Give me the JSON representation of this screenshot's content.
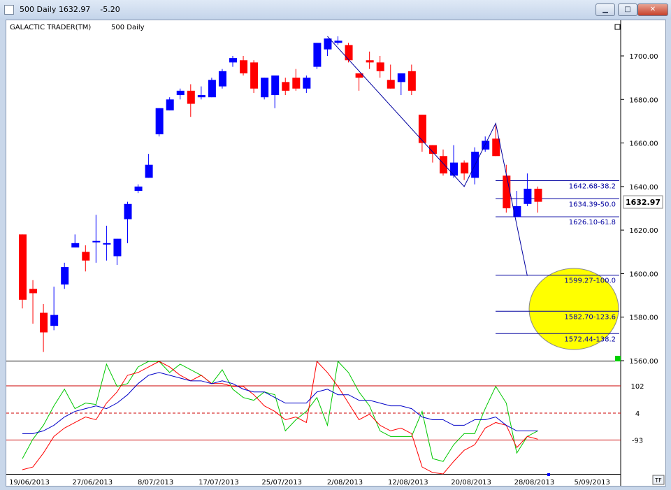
{
  "window": {
    "title": "500 Daily 1632.97    -5.20",
    "minimize_glyph": "▁",
    "maximize_glyph": "□",
    "close_glyph": "✕"
  },
  "chart_header": {
    "name": "GALACTIC TRADER(TM)",
    "instrument": "500 Daily"
  },
  "last_price_label": "1632.97",
  "tf_button": "TF",
  "colors": {
    "up": "#0000ff",
    "down": "#ff0000",
    "highlight": "#ffff00"
  },
  "chart_data": [
    {
      "type": "candlestick",
      "price_ylim": [
        1560,
        1710
      ],
      "y_ticks": [
        "1700.00",
        "1680.00",
        "1660.00",
        "1640.00",
        "1620.00",
        "1600.00",
        "1580.00",
        "1560.00"
      ],
      "x_ticks": [
        "19/06/2013",
        "27/06/2013",
        "8/07/2013",
        "17/07/2013",
        "25/07/2013",
        "2/08/2013",
        "12/08/2013",
        "20/08/2013",
        "28/08/2013",
        "5/09/2013"
      ],
      "candles": [
        [
          1618,
          1618,
          1584,
          1588
        ],
        [
          1593,
          1597,
          1577,
          1591
        ],
        [
          1582,
          1586,
          1564,
          1573
        ],
        [
          1576,
          1594,
          1574,
          1581
        ],
        [
          1595,
          1605,
          1593,
          1603
        ],
        [
          1612,
          1618,
          1612,
          1614
        ],
        [
          1610,
          1613,
          1601,
          1606
        ],
        [
          1615,
          1627,
          1605,
          1615
        ],
        [
          1614,
          1622,
          1606,
          1614
        ],
        [
          1608,
          1616,
          1604,
          1616
        ],
        [
          1625,
          1633,
          1614,
          1632
        ],
        [
          1638,
          1641,
          1637,
          1640
        ],
        [
          1644,
          1655,
          1644,
          1650
        ],
        [
          1664,
          1676,
          1663,
          1676
        ],
        [
          1675,
          1681,
          1675,
          1680
        ],
        [
          1682,
          1685,
          1680,
          1684
        ],
        [
          1684,
          1687,
          1672,
          1678
        ],
        [
          1681,
          1686,
          1680,
          1682
        ],
        [
          1681,
          1690,
          1681,
          1689
        ],
        [
          1686,
          1694,
          1685,
          1693
        ],
        [
          1697,
          1700,
          1695,
          1699
        ],
        [
          1698,
          1700,
          1691,
          1692
        ],
        [
          1697,
          1698,
          1683,
          1685
        ],
        [
          1681,
          1690,
          1680,
          1690
        ],
        [
          1682,
          1691,
          1676,
          1691
        ],
        [
          1688,
          1690,
          1682,
          1684
        ],
        [
          1690,
          1694,
          1684,
          1685
        ],
        [
          1685,
          1691,
          1683,
          1690
        ],
        [
          1695,
          1706,
          1694,
          1706
        ],
        [
          1703,
          1708,
          1700,
          1708
        ],
        [
          1706,
          1709,
          1705,
          1707
        ],
        [
          1705,
          1706,
          1697,
          1698
        ],
        [
          1692,
          1692,
          1684,
          1690
        ],
        [
          1698,
          1702,
          1694,
          1697
        ],
        [
          1697,
          1700,
          1690,
          1693
        ],
        [
          1689,
          1696,
          1685,
          1685
        ],
        [
          1688,
          1692,
          1682,
          1692
        ],
        [
          1693,
          1696,
          1682,
          1684
        ],
        [
          1673,
          1673,
          1656,
          1660
        ],
        [
          1659,
          1659,
          1651,
          1655
        ],
        [
          1654,
          1657,
          1645,
          1646
        ],
        [
          1645,
          1659,
          1644,
          1651
        ],
        [
          1651,
          1652,
          1643,
          1646
        ],
        [
          1644,
          1658,
          1641,
          1656
        ],
        [
          1657,
          1663,
          1656,
          1661
        ],
        [
          1662,
          1669,
          1654,
          1654
        ],
        [
          1645,
          1650,
          1628,
          1630
        ],
        [
          1626,
          1638,
          1626,
          1631
        ],
        [
          1632,
          1646,
          1631,
          1639
        ],
        [
          1639,
          1640,
          1628,
          1633
        ]
      ],
      "fib_levels": [
        {
          "price": 1642.68,
          "label": "1642.68-38.2"
        },
        {
          "price": 1634.39,
          "label": "1634.39-50.0"
        },
        {
          "price": 1626.1,
          "label": "1626.10-61.8"
        },
        {
          "price": 1599.27,
          "label": "1599.27-100.0"
        },
        {
          "price": 1582.7,
          "label": "1582.70-123.6"
        },
        {
          "price": 1572.44,
          "label": "1572.44-138.2"
        }
      ],
      "wave_line": [
        [
          29,
          1709
        ],
        [
          42,
          1640
        ],
        [
          45,
          1669
        ],
        [
          48,
          1599
        ]
      ]
    },
    {
      "type": "line",
      "y_ticks": [
        "102",
        "4",
        "-93"
      ],
      "ylim": [
        -215,
        190
      ],
      "levels": [
        102,
        4,
        -93
      ],
      "series": [
        {
          "color": "#00c800",
          "values": [
            -160,
            -90,
            -40,
            30,
            90,
            20,
            40,
            35,
            180,
            100,
            110,
            170,
            210,
            200,
            150,
            180,
            160,
            140,
            110,
            160,
            90,
            60,
            50,
            80,
            70,
            -60,
            -20,
            10,
            60,
            -40,
            190,
            150,
            80,
            30,
            -60,
            -80,
            -80,
            -80,
            10,
            -160,
            -170,
            -110,
            -70,
            -70,
            20,
            100,
            40,
            -140,
            -80,
            -60
          ]
        },
        {
          "color": "#ff0000",
          "values": [
            -200,
            -190,
            -140,
            -80,
            -50,
            -30,
            -10,
            -20,
            40,
            80,
            140,
            150,
            170,
            190,
            170,
            140,
            120,
            140,
            110,
            110,
            100,
            100,
            70,
            30,
            10,
            -20,
            -10,
            -30,
            190,
            150,
            100,
            40,
            -20,
            0,
            -40,
            -60,
            -50,
            -70,
            -190,
            -210,
            -220,
            -170,
            -130,
            -110,
            -50,
            -30,
            -40,
            -120,
            -80,
            -90
          ]
        },
        {
          "color": "#0000c8",
          "values": [
            -70,
            -70,
            -60,
            -40,
            -10,
            10,
            20,
            30,
            20,
            40,
            70,
            110,
            140,
            150,
            140,
            130,
            120,
            120,
            110,
            120,
            110,
            90,
            80,
            80,
            60,
            40,
            40,
            40,
            80,
            90,
            70,
            70,
            50,
            50,
            40,
            30,
            30,
            20,
            -10,
            -20,
            -20,
            -40,
            -40,
            -20,
            -20,
            -10,
            -40,
            -60,
            -60,
            -60
          ]
        }
      ]
    }
  ]
}
